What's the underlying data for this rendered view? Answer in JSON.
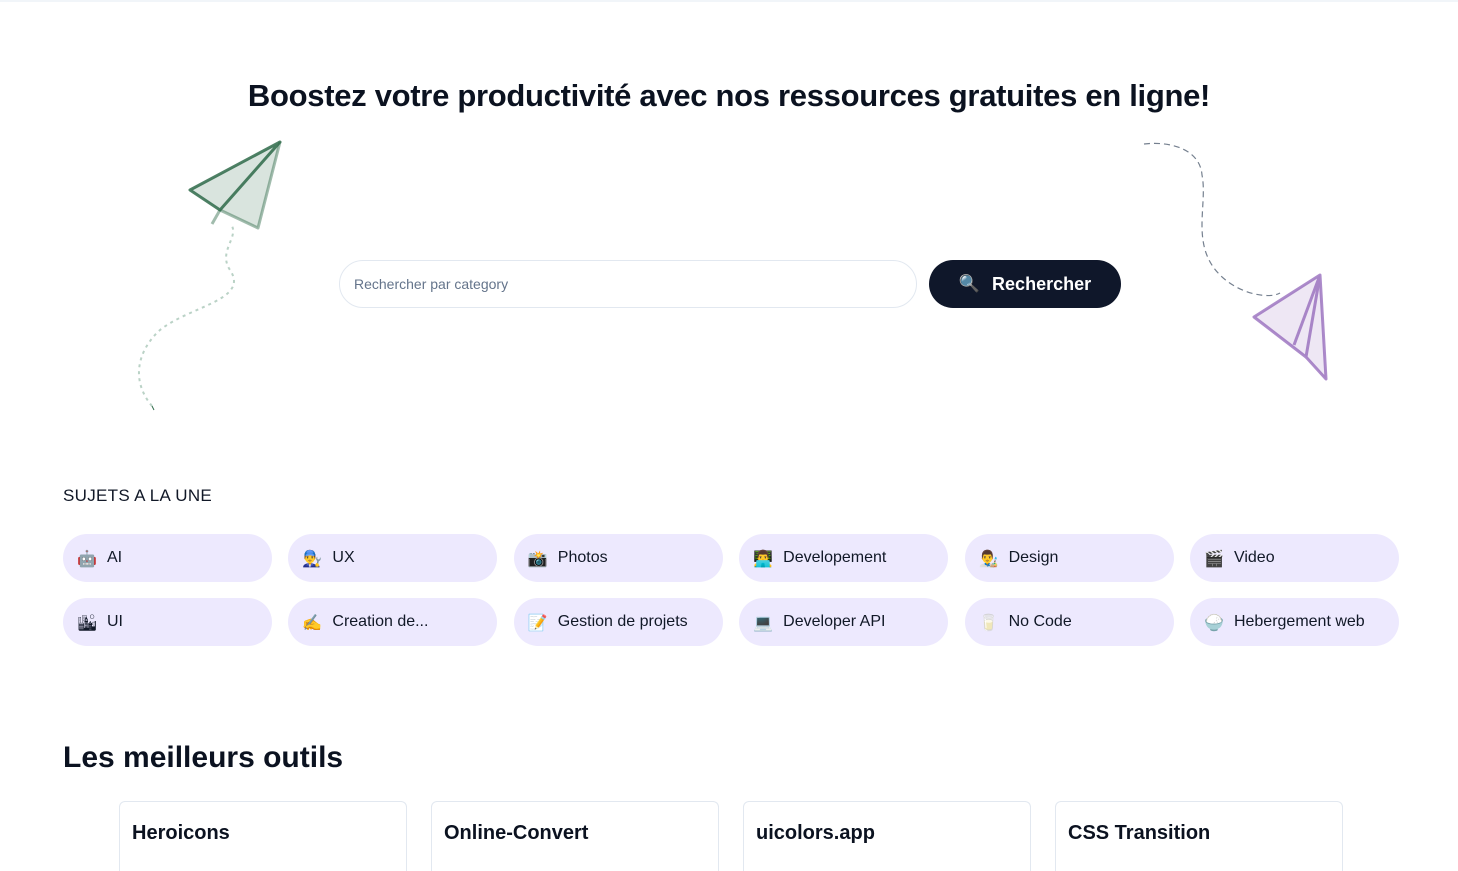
{
  "hero": {
    "title": "Boostez votre productivité avec nos ressources gratuites en ligne!"
  },
  "search": {
    "placeholder": "Rechercher par category",
    "button_label": "Rechercher",
    "button_icon": "🔍"
  },
  "featured": {
    "label": "SUJETS A LA UNE",
    "chips": [
      {
        "emoji": "🤖",
        "label": "AI"
      },
      {
        "emoji": "👨‍🔧",
        "label": "UX"
      },
      {
        "emoji": "📸",
        "label": "Photos"
      },
      {
        "emoji": "👨‍💻",
        "label": "Developement"
      },
      {
        "emoji": "👨‍🎨",
        "label": "Design"
      },
      {
        "emoji": "🎬",
        "label": "Video"
      },
      {
        "emoji": "🏙",
        "label": "UI"
      },
      {
        "emoji": "✍️",
        "label": "Creation de..."
      },
      {
        "emoji": "📝",
        "label": "Gestion de projets"
      },
      {
        "emoji": "💻",
        "label": "Developer API"
      },
      {
        "emoji": "🥛",
        "label": "No Code"
      },
      {
        "emoji": "🍚",
        "label": "Hebergement web"
      }
    ]
  },
  "tools": {
    "title": "Les meilleurs outils",
    "cards": [
      {
        "title": "Heroicons"
      },
      {
        "title": "Online-Convert"
      },
      {
        "title": "uicolors.app"
      },
      {
        "title": "CSS Transition"
      }
    ]
  },
  "colors": {
    "chip_bg": "#ede9fe",
    "button_bg": "#0f172a",
    "plane_green": "#2f6b4a",
    "plane_purple": "#8b5cb6"
  }
}
